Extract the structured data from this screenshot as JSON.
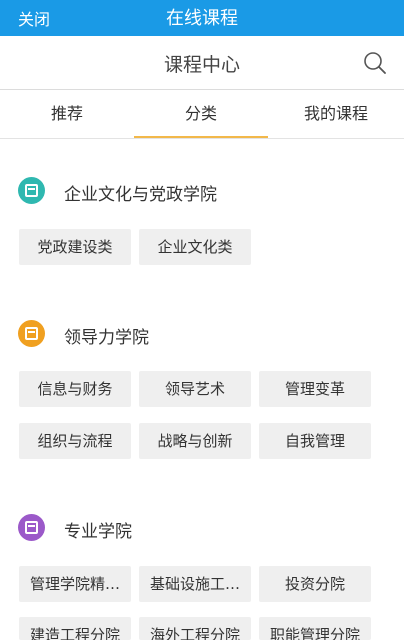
{
  "top_bar": {
    "close_label": "关闭",
    "title": "在线课程"
  },
  "header": {
    "title": "课程中心",
    "search_icon": "search-icon"
  },
  "tabs": [
    {
      "label": "推荐"
    },
    {
      "label": "分类",
      "active": true
    },
    {
      "label": "我的课程"
    }
  ],
  "colors": {
    "accent": "#1a9ae6",
    "tab_underline": "#f2b84a"
  },
  "sections": [
    {
      "title": "企业文化与党政学院",
      "icon_color": "#2fb8b0",
      "chips": [
        "党政建设类",
        "企业文化类"
      ]
    },
    {
      "title": "领导力学院",
      "icon_color": "#f0a020",
      "chips": [
        "信息与财务",
        "领导艺术",
        "管理变革",
        "组织与流程",
        "战略与创新",
        "自我管理"
      ]
    },
    {
      "title": "专业学院",
      "icon_color": "#9b59c9",
      "chips": [
        "管理学院精…",
        "基础设施工…",
        "投资分院",
        "建造工程分院",
        "海外工程分院",
        "职能管理分院"
      ]
    }
  ]
}
